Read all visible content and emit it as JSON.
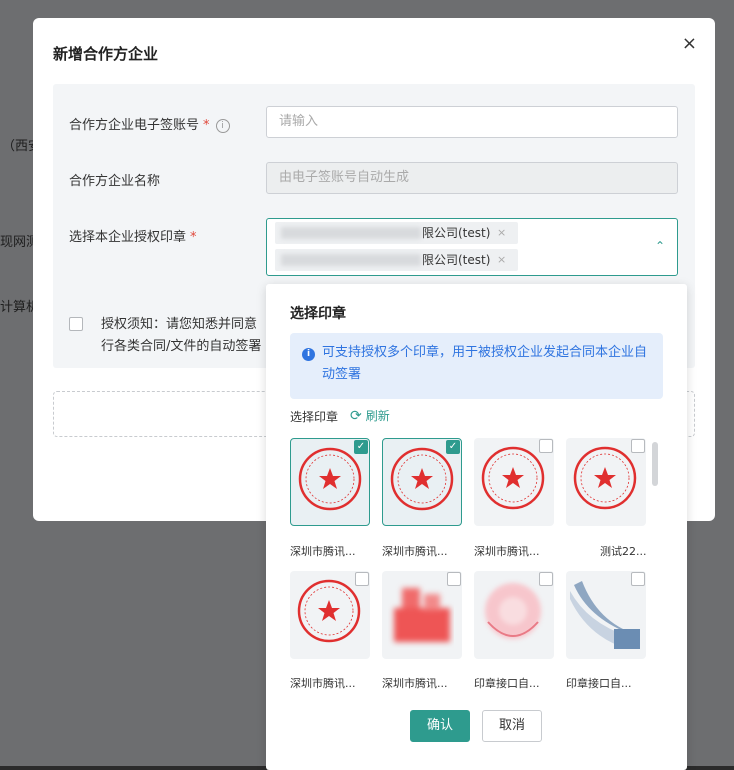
{
  "background": {
    "fragments": [
      "（西安",
      "现网测",
      "计算机"
    ]
  },
  "modal": {
    "title": "新增合作方企业",
    "close_icon": "×",
    "fields": {
      "account_label": "合作方企业电子签账号",
      "account_required": "*",
      "account_info_icon": "i",
      "account_placeholder": "请输入",
      "name_label": "合作方企业名称",
      "name_placeholder": "由电子签账号自动生成",
      "seal_label": "选择本企业授权印章",
      "seal_required": "*"
    },
    "selected_tags": [
      {
        "suffix": "限公司(test)",
        "remove": "×"
      },
      {
        "suffix": "限公司(test)",
        "remove": "×"
      }
    ],
    "chevron": "⌃",
    "agreement": {
      "line1": "授权须知：请您知悉并同意",
      "line2": "行各类合同/文件的自动签署"
    }
  },
  "dropdown": {
    "title": "选择印章",
    "notice_icon": "i",
    "notice_text": "可支持授权多个印章，用于被授权企业发起合同本企业自动签署",
    "sub_label": "选择印章",
    "refresh_icon": "⟳",
    "refresh_label": "刷新",
    "check_mark": "✓",
    "seals": [
      {
        "label": "深圳市腾讯...",
        "selected": true,
        "kind": "stamp"
      },
      {
        "label": "深圳市腾讯...",
        "selected": true,
        "kind": "stamp"
      },
      {
        "label": "深圳市腾讯...",
        "selected": false,
        "kind": "stamp"
      },
      {
        "label": "测试22...",
        "selected": false,
        "kind": "stamp"
      },
      {
        "label": "深圳市腾讯...",
        "selected": false,
        "kind": "stamp"
      },
      {
        "label": "深圳市腾讯...",
        "selected": false,
        "kind": "blurred-red"
      },
      {
        "label": "印章接口自...",
        "selected": false,
        "kind": "blurred-pink"
      },
      {
        "label": "印章接口自...",
        "selected": false,
        "kind": "image"
      }
    ],
    "confirm_label": "确认",
    "cancel_label": "取消"
  },
  "colors": {
    "accent": "#2e9b8e",
    "required": "#e0473a",
    "notice_text": "#2f74e0",
    "notice_bg": "#e5eefb",
    "stamp_red": "#e02f2f"
  }
}
